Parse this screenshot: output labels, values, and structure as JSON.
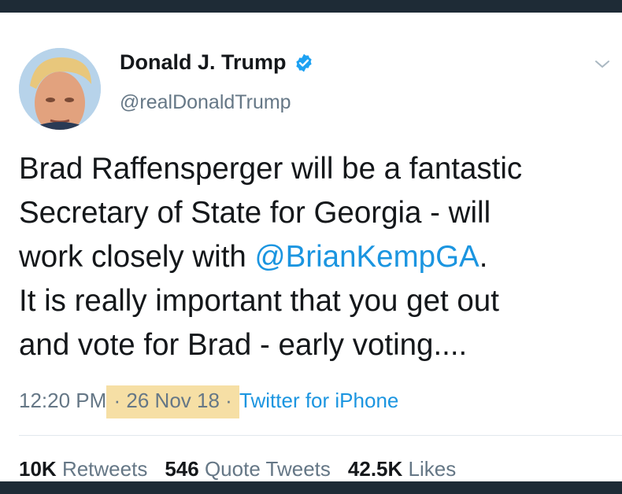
{
  "author": {
    "name": "Donald J. Trump",
    "handle": "@realDonaldTrump",
    "avatar_icon": "profile-photo",
    "verified_icon": "verified-badge-icon"
  },
  "tweet": {
    "line1": "Brad Raffensperger will be a fantastic",
    "line2": "Secretary of State for Georgia - will",
    "line3_prefix": "work closely with ",
    "line3_mention": "@BrianKempGA",
    "line3_suffix": ".",
    "line4": "It is really important that you get out",
    "line5": "and vote for Brad - early voting...."
  },
  "meta": {
    "time": "12:20 PM",
    "sep1": " · ",
    "date": "26 Nov 18",
    "sep2": " · ",
    "source": "Twitter for iPhone"
  },
  "stats": {
    "retweets_count": "10K",
    "retweets_label": "Retweets",
    "quotes_count": "546",
    "quotes_label": "Quote Tweets",
    "likes_count": "42.5K",
    "likes_label": "Likes"
  },
  "colors": {
    "link": "#1b95e0",
    "secondary": "#657786",
    "highlight": "#f6dfa5",
    "frame": "#1e2b36"
  }
}
